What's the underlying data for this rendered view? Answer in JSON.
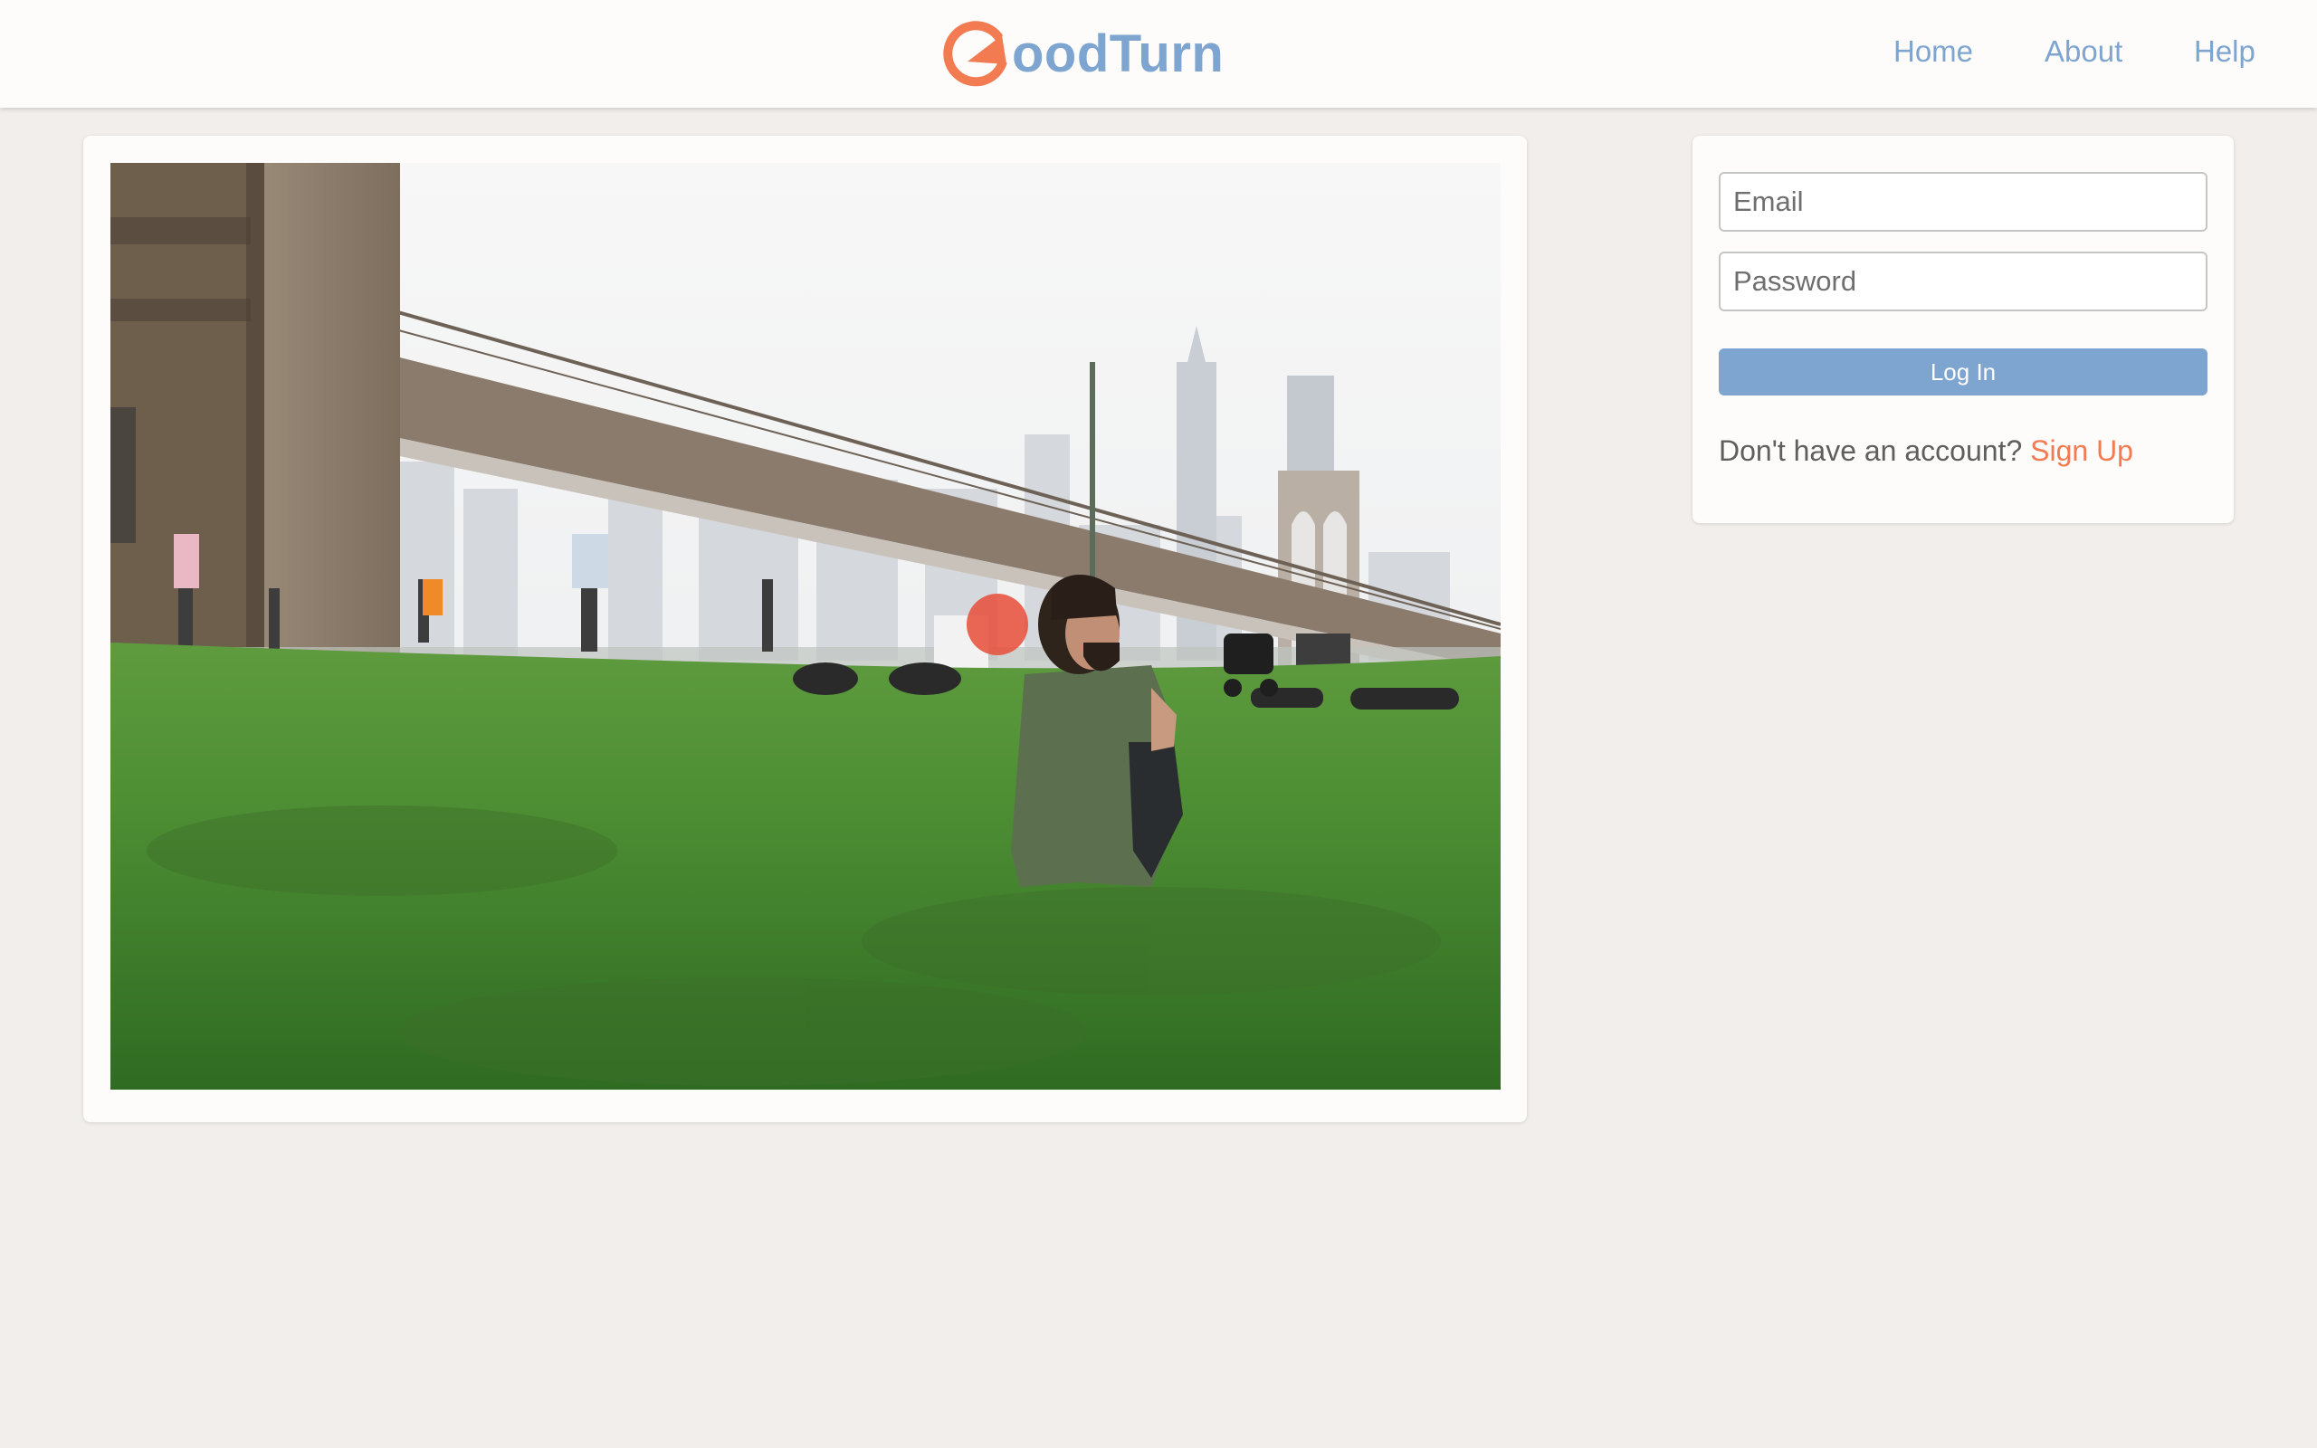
{
  "header": {
    "logo_text": "oodTurn",
    "nav": {
      "home": "Home",
      "about": "About",
      "help": "Help"
    }
  },
  "hero": {
    "image_subject": "park-photo"
  },
  "login": {
    "email_placeholder": "Email",
    "password_placeholder": "Password",
    "button_label": "Log In",
    "signup_prompt": "Don't have an account?",
    "signup_link": "Sign Up"
  },
  "colors": {
    "brand_orange": "#f27b52",
    "brand_blue": "#7ea5cf",
    "background": "#f1eeeb",
    "card": "#fdfcfb"
  },
  "icons": {
    "logo_mark": "circular-arrow-g-icon"
  }
}
